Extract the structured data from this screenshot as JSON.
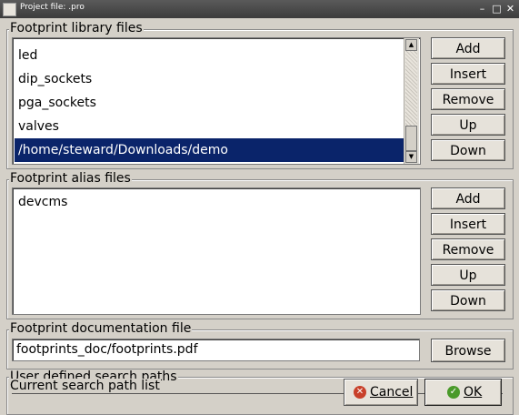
{
  "window": {
    "title": "Project file: .pro",
    "minimize_glyph": "–",
    "maximize_glyph": "□",
    "close_glyph": "✕"
  },
  "library_group": {
    "label": "Footprint library files",
    "items": [
      {
        "label": "led"
      },
      {
        "label": "dip_sockets"
      },
      {
        "label": "pga_sockets"
      },
      {
        "label": "valves"
      },
      {
        "label": "/home/steward/Downloads/demo",
        "selected": true
      }
    ],
    "buttons": {
      "add": "Add",
      "insert": "Insert",
      "remove": "Remove",
      "up": "Up",
      "down": "Down"
    }
  },
  "alias_group": {
    "label": "Footprint alias files",
    "items": [
      {
        "label": "devcms"
      }
    ],
    "buttons": {
      "add": "Add",
      "insert": "Insert",
      "remove": "Remove",
      "up": "Up",
      "down": "Down"
    }
  },
  "doc_group": {
    "label": "Footprint documentation file",
    "value": "footprints_doc/footprints.pdf",
    "browse": "Browse"
  },
  "search_group": {
    "label": "User defined search paths",
    "current_label": "Current search path list"
  },
  "dialog_buttons": {
    "cancel": "Cancel",
    "ok": "OK"
  },
  "icons": {
    "cancel": "cancel-icon",
    "ok": "ok-icon",
    "scroll_up": "arrow-up-icon",
    "scroll_down": "arrow-down-icon"
  },
  "colors": {
    "selection": "#0a246a",
    "dialog_bg": "#d4d0c8"
  }
}
